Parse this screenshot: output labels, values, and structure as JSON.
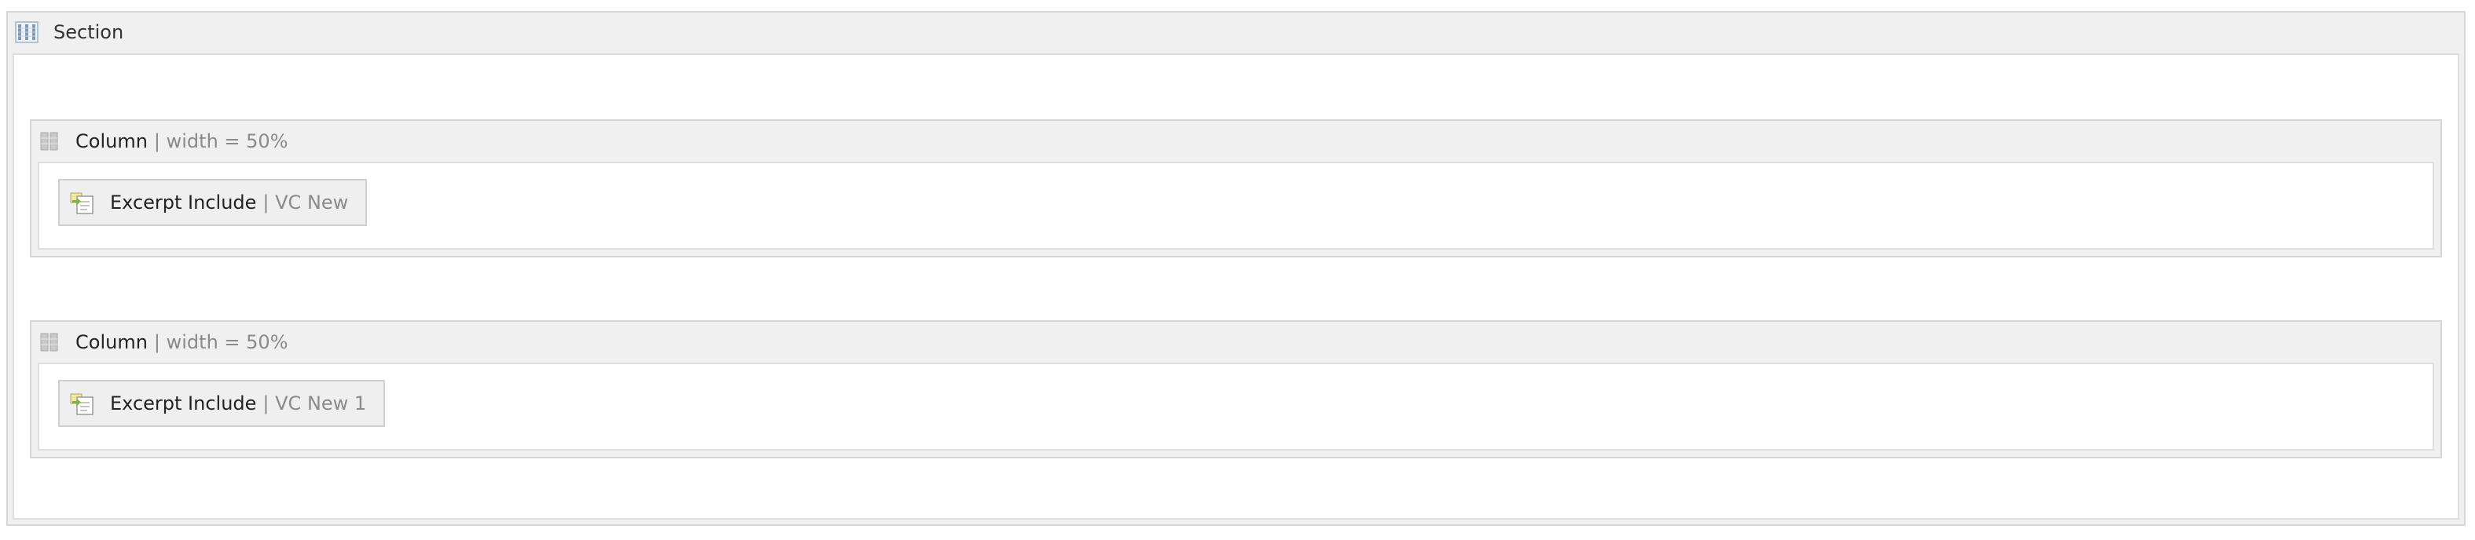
{
  "section": {
    "title": "Section",
    "icon": "section-icon"
  },
  "columns": [
    {
      "title": "Column",
      "detail": "| width = 50%",
      "icon": "column-drag-icon",
      "widget": {
        "title": "Excerpt Include",
        "detail": "| VC New",
        "icon": "excerpt-include-icon"
      }
    },
    {
      "title": "Column",
      "detail": "| width = 50%",
      "icon": "column-drag-icon",
      "widget": {
        "title": "Excerpt Include",
        "detail": "| VC New 1",
        "icon": "excerpt-include-icon"
      }
    }
  ]
}
